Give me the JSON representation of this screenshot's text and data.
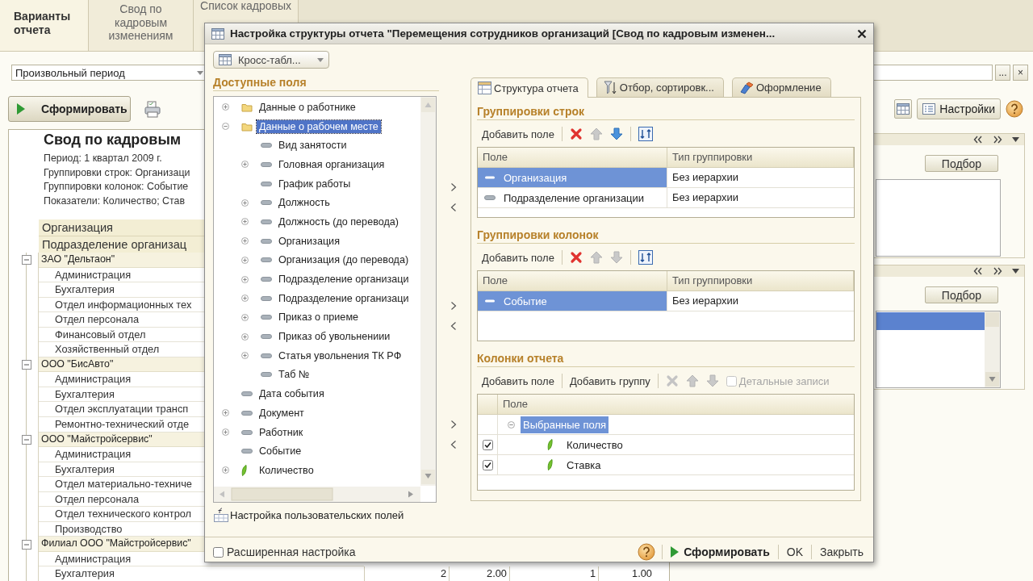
{
  "background": {
    "tabs": [
      {
        "label": "Варианты отчета",
        "selected": true
      },
      {
        "label": "Свод по кадровым изменениям",
        "selected": false
      },
      {
        "label": "Список кадровых",
        "selected": false
      }
    ],
    "period_field": {
      "value": "Произвольный период"
    },
    "field_buttons": [
      "...",
      "×"
    ],
    "generate_button": "Сформировать",
    "settings_button": "Настройки",
    "report": {
      "title": "Свод по кадровым",
      "info": [
        "Период: 1 квартал 2009 г.",
        "Группировки строк: Организаци",
        "Группировки колонок: Событие",
        "Показатели: Количество; Став"
      ],
      "headers": [
        "Организация",
        "Подразделение организац"
      ],
      "groups": [
        {
          "name": "ЗАО \"Дельтаон\"",
          "expanded": true,
          "rows": [
            {
              "name": "Администрация"
            },
            {
              "name": "Бухгалтерия"
            },
            {
              "name": "Отдел информационных тех"
            },
            {
              "name": "Отдел персонала"
            },
            {
              "name": "Финансовый отдел"
            },
            {
              "name": "Хозяйственный отдел"
            }
          ]
        },
        {
          "name": "ООО \"БисАвто\"",
          "expanded": true,
          "rows": [
            {
              "name": "Администрация"
            },
            {
              "name": "Бухгалтерия"
            },
            {
              "name": "Отдел эксплуатации трансп"
            },
            {
              "name": "Ремонтно-технический отде"
            }
          ]
        },
        {
          "name": "ООО \"Майстройсервис\"",
          "expanded": true,
          "rows": [
            {
              "name": "Администрация"
            },
            {
              "name": "Бухгалтерия"
            },
            {
              "name": "Отдел материально-техниче"
            },
            {
              "name": "Отдел персонала"
            },
            {
              "name": "Отдел технического контрол"
            },
            {
              "name": "Производство"
            }
          ]
        },
        {
          "name": "Филиал ООО \"Майстройсервис\"",
          "expanded": true,
          "rows": [
            {
              "name": "Администрация"
            },
            {
              "name": "Бухгалтерия",
              "values": [
                "2",
                "2.00",
                "1",
                "1.00"
              ]
            }
          ]
        }
      ]
    },
    "panels": [
      {
        "button": "Подбор"
      },
      {
        "button": "Подбор",
        "rows": [
          {
            "selected": true
          }
        ]
      }
    ]
  },
  "dialog": {
    "title": "Настройка структуры отчета \"Перемещения сотрудников организаций [Свод по кадровым изменен...",
    "view_select": "Кросс-табл...",
    "available_heading": "Доступные поля",
    "tree": [
      {
        "label": "Данные о работнике",
        "kind": "folder",
        "expandable": true,
        "selected": false
      },
      {
        "label": "Данные о рабочем месте",
        "kind": "folder",
        "expandable": true,
        "expanded": true,
        "selected": true,
        "children": [
          {
            "label": "Вид занятости",
            "kind": "field",
            "expandable": false,
            "selected": false
          },
          {
            "label": "Головная организация",
            "kind": "field",
            "expandable": true,
            "selected": false
          },
          {
            "label": "График работы",
            "kind": "field",
            "expandable": false,
            "selected": false
          },
          {
            "label": "Должность",
            "kind": "field",
            "expandable": true,
            "selected": false
          },
          {
            "label": "Должность (до перевода)",
            "kind": "field",
            "expandable": true,
            "selected": false
          },
          {
            "label": "Организация",
            "kind": "field",
            "expandable": true,
            "selected": false
          },
          {
            "label": "Организация (до перевода)",
            "kind": "field",
            "expandable": true,
            "selected": false
          },
          {
            "label": "Подразделение организаци",
            "kind": "field",
            "expandable": true,
            "selected": false
          },
          {
            "label": "Подразделение организаци",
            "kind": "field",
            "expandable": true,
            "selected": false
          },
          {
            "label": "Приказ о приеме",
            "kind": "field",
            "expandable": true,
            "selected": false
          },
          {
            "label": "Приказ об увольнениии",
            "kind": "field",
            "expandable": true,
            "selected": false
          },
          {
            "label": "Статья увольнения ТК РФ",
            "kind": "field",
            "expandable": true,
            "selected": false
          },
          {
            "label": "Таб №",
            "kind": "field",
            "expandable": false,
            "selected": false
          }
        ]
      },
      {
        "label": "Дата события",
        "kind": "field",
        "expandable": false,
        "selected": false
      },
      {
        "label": "Документ",
        "kind": "field",
        "expandable": true,
        "selected": false
      },
      {
        "label": "Работник",
        "kind": "field",
        "expandable": true,
        "selected": false
      },
      {
        "label": "Событие",
        "kind": "field",
        "expandable": false,
        "selected": false
      },
      {
        "label": "Количество",
        "kind": "resource",
        "expandable": true,
        "selected": false
      }
    ],
    "custom_fields_link": "Настройка пользовательских полей",
    "tabs": [
      {
        "label": "Структура отчета",
        "kind": "structure",
        "selected": true
      },
      {
        "label": "Отбор, сортировк...",
        "kind": "filter",
        "selected": false
      },
      {
        "label": "Оформление",
        "kind": "design",
        "selected": false
      }
    ],
    "sections": [
      {
        "heading": "Группировки строк",
        "kind": "grouping",
        "toolbar": [
          {
            "kind": "add",
            "label": "Добавить поле",
            "disabled": false
          },
          {
            "kind": "delete",
            "disabled": false
          },
          {
            "kind": "up",
            "disabled": true
          },
          {
            "kind": "down",
            "disabled": false
          },
          {
            "kind": "swap",
            "disabled": false
          }
        ],
        "columns": [
          "Поле",
          "Тип группировки"
        ],
        "rows": [
          {
            "field": "Организация",
            "type": "Без иерархии",
            "selected": true
          },
          {
            "field": "Подразделение организации",
            "type": "Без иерархии",
            "selected": false
          }
        ]
      },
      {
        "heading": "Группировки колонок",
        "kind": "grouping",
        "toolbar": [
          {
            "kind": "add",
            "label": "Добавить поле",
            "disabled": false
          },
          {
            "kind": "delete",
            "disabled": false
          },
          {
            "kind": "up",
            "disabled": true
          },
          {
            "kind": "down",
            "disabled": true
          },
          {
            "kind": "swap",
            "disabled": false
          }
        ],
        "columns": [
          "Поле",
          "Тип группировки"
        ],
        "rows": [
          {
            "field": "Событие",
            "type": "Без иерархии",
            "selected": true
          }
        ]
      },
      {
        "heading": "Колонки отчета",
        "kind": "columns",
        "toolbar": [
          {
            "kind": "add",
            "label": "Добавить поле",
            "disabled": false
          },
          {
            "kind": "add",
            "label": "Добавить группу",
            "disabled": false
          },
          {
            "kind": "delete",
            "disabled": true
          },
          {
            "kind": "up",
            "disabled": true
          },
          {
            "kind": "down",
            "disabled": true
          },
          {
            "kind": "checkbox",
            "label": "Детальные записи",
            "checked": false,
            "disabled": true
          }
        ],
        "columns": [
          "Поле"
        ],
        "rows": [
          {
            "field": "Выбранные поля",
            "expanded": true,
            "selected": true,
            "children": [
              {
                "field": "Количество",
                "checked": true,
                "selected": false
              },
              {
                "field": "Ставка",
                "checked": true,
                "selected": false
              }
            ]
          }
        ]
      }
    ],
    "extended_settings": {
      "label": "Расширенная настройка",
      "checked": false
    },
    "buttons": [
      {
        "kind": "generate",
        "label": "Сформировать"
      },
      {
        "kind": "plain",
        "label": "OK"
      },
      {
        "kind": "plain",
        "label": "Закрыть"
      }
    ]
  }
}
